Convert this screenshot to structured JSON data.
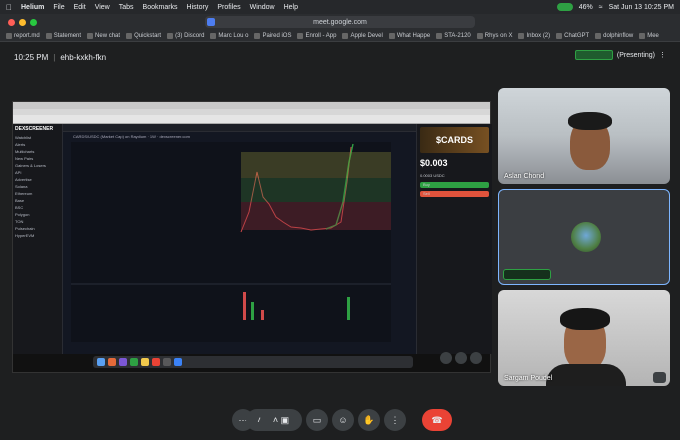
{
  "menubar": {
    "app": "Helium",
    "items": [
      "File",
      "Edit",
      "View",
      "Tabs",
      "Bookmarks",
      "History",
      "Profiles",
      "Window",
      "Help"
    ],
    "battery": "46%",
    "clock": "Sat Jun 13  10:25 PM"
  },
  "browser": {
    "url": "meet.google.com",
    "bookmarks": [
      "report.md",
      "Statement",
      "New chat",
      "Quickstart",
      "(3) Discord",
      "Marc Lou o",
      "Paired iOS",
      "Enroll - App",
      "Apple Devel",
      "What Happe",
      "STA-2120",
      "Rhys on X",
      "Inbox (2)",
      "ChatGPT",
      "dolphinflow",
      "Mee"
    ]
  },
  "meet": {
    "time": "10:25 PM",
    "code": "ehb-kxkh-fkn",
    "presenting": "(Presenting)"
  },
  "shared_screen": {
    "brand": "DEXSCREENER",
    "pair": "CARDS/USDC (Market Cap) on Raydium · 1W · dexscreener.com",
    "token": "$CARDS",
    "nav": [
      "Watchlist",
      "Alerts",
      "Multicharts",
      "New Pairs",
      "Gainers & Losers",
      "API",
      "Advertise",
      "Solana",
      "Ethereum",
      "Base",
      "BSC",
      "Polygon",
      "TON",
      "Pulsechain",
      "HyperEVM"
    ],
    "price_usd": "$0.003",
    "price_sol": "0.0003 USDC",
    "buy": "Buy",
    "sell": "Sell"
  },
  "participants": [
    {
      "name": "Aslan Chond"
    },
    {
      "name": ""
    },
    {
      "name": "Sargam Poudel"
    }
  ],
  "controls": [
    "more",
    "mic",
    "camera",
    "present",
    "emoji",
    "raise-hand",
    "captions",
    "end-call"
  ]
}
